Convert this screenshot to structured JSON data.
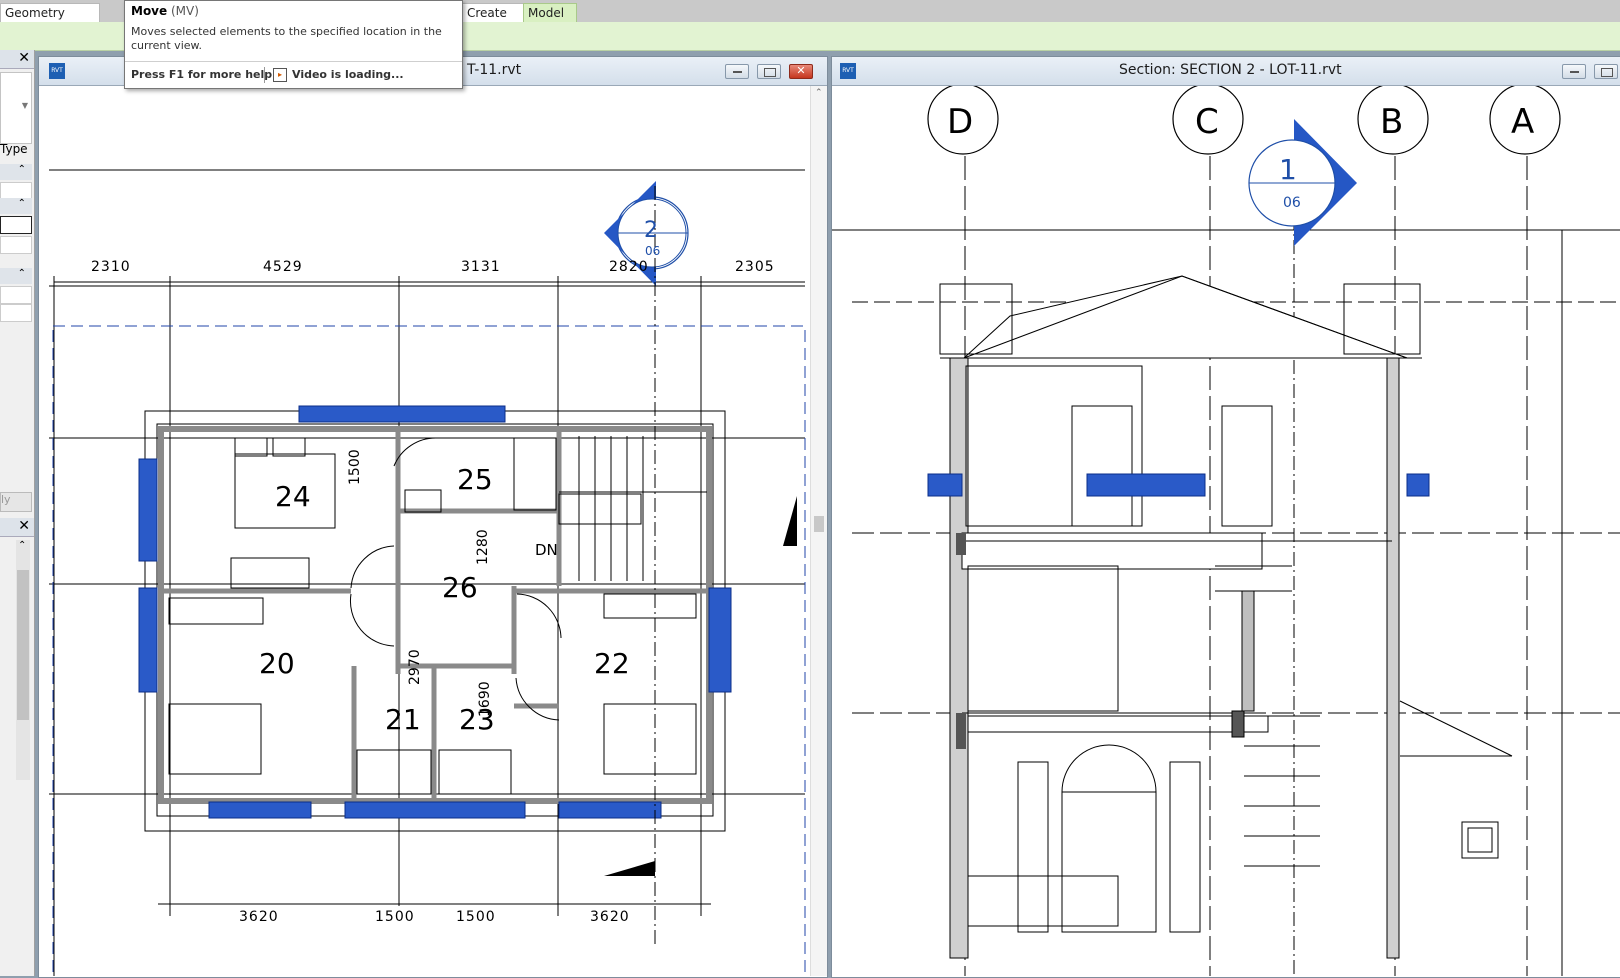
{
  "ribbon": {
    "tab_geometry": "Geometry",
    "tab_create": "Create",
    "tab_model": "Model"
  },
  "tooltip": {
    "title": "Move",
    "shortcut": "(MV)",
    "description": "Moves selected elements to the specified location in the current view.",
    "help": "Press F1 for more help",
    "video": "Video is loading..."
  },
  "left_panel": {
    "type_label": "Type",
    "ly_label": "ly"
  },
  "plan_view": {
    "title_fragment": "T-11.rvt",
    "top_dimensions": [
      "2310",
      "4529",
      "3131",
      "2820",
      "2305"
    ],
    "bottom_dimensions": [
      "3620",
      "1500",
      "1500",
      "3620"
    ],
    "rooms": [
      "24",
      "25",
      "26",
      "20",
      "22",
      "21",
      "23"
    ],
    "stair_label": "DN",
    "interior_dimensions": [
      "1500",
      "1280",
      "2970",
      "1690"
    ],
    "section_marker": {
      "number": "2",
      "sheet": "06"
    }
  },
  "section_view": {
    "title": "Section: SECTION 2 - LOT-11.rvt",
    "grid_labels": [
      "D",
      "C",
      "B",
      "A"
    ],
    "section_marker": {
      "number": "1",
      "sheet": "06"
    }
  },
  "colors": {
    "selection_blue": "#2255c8",
    "ribbon_green": "#e2f3d2"
  }
}
